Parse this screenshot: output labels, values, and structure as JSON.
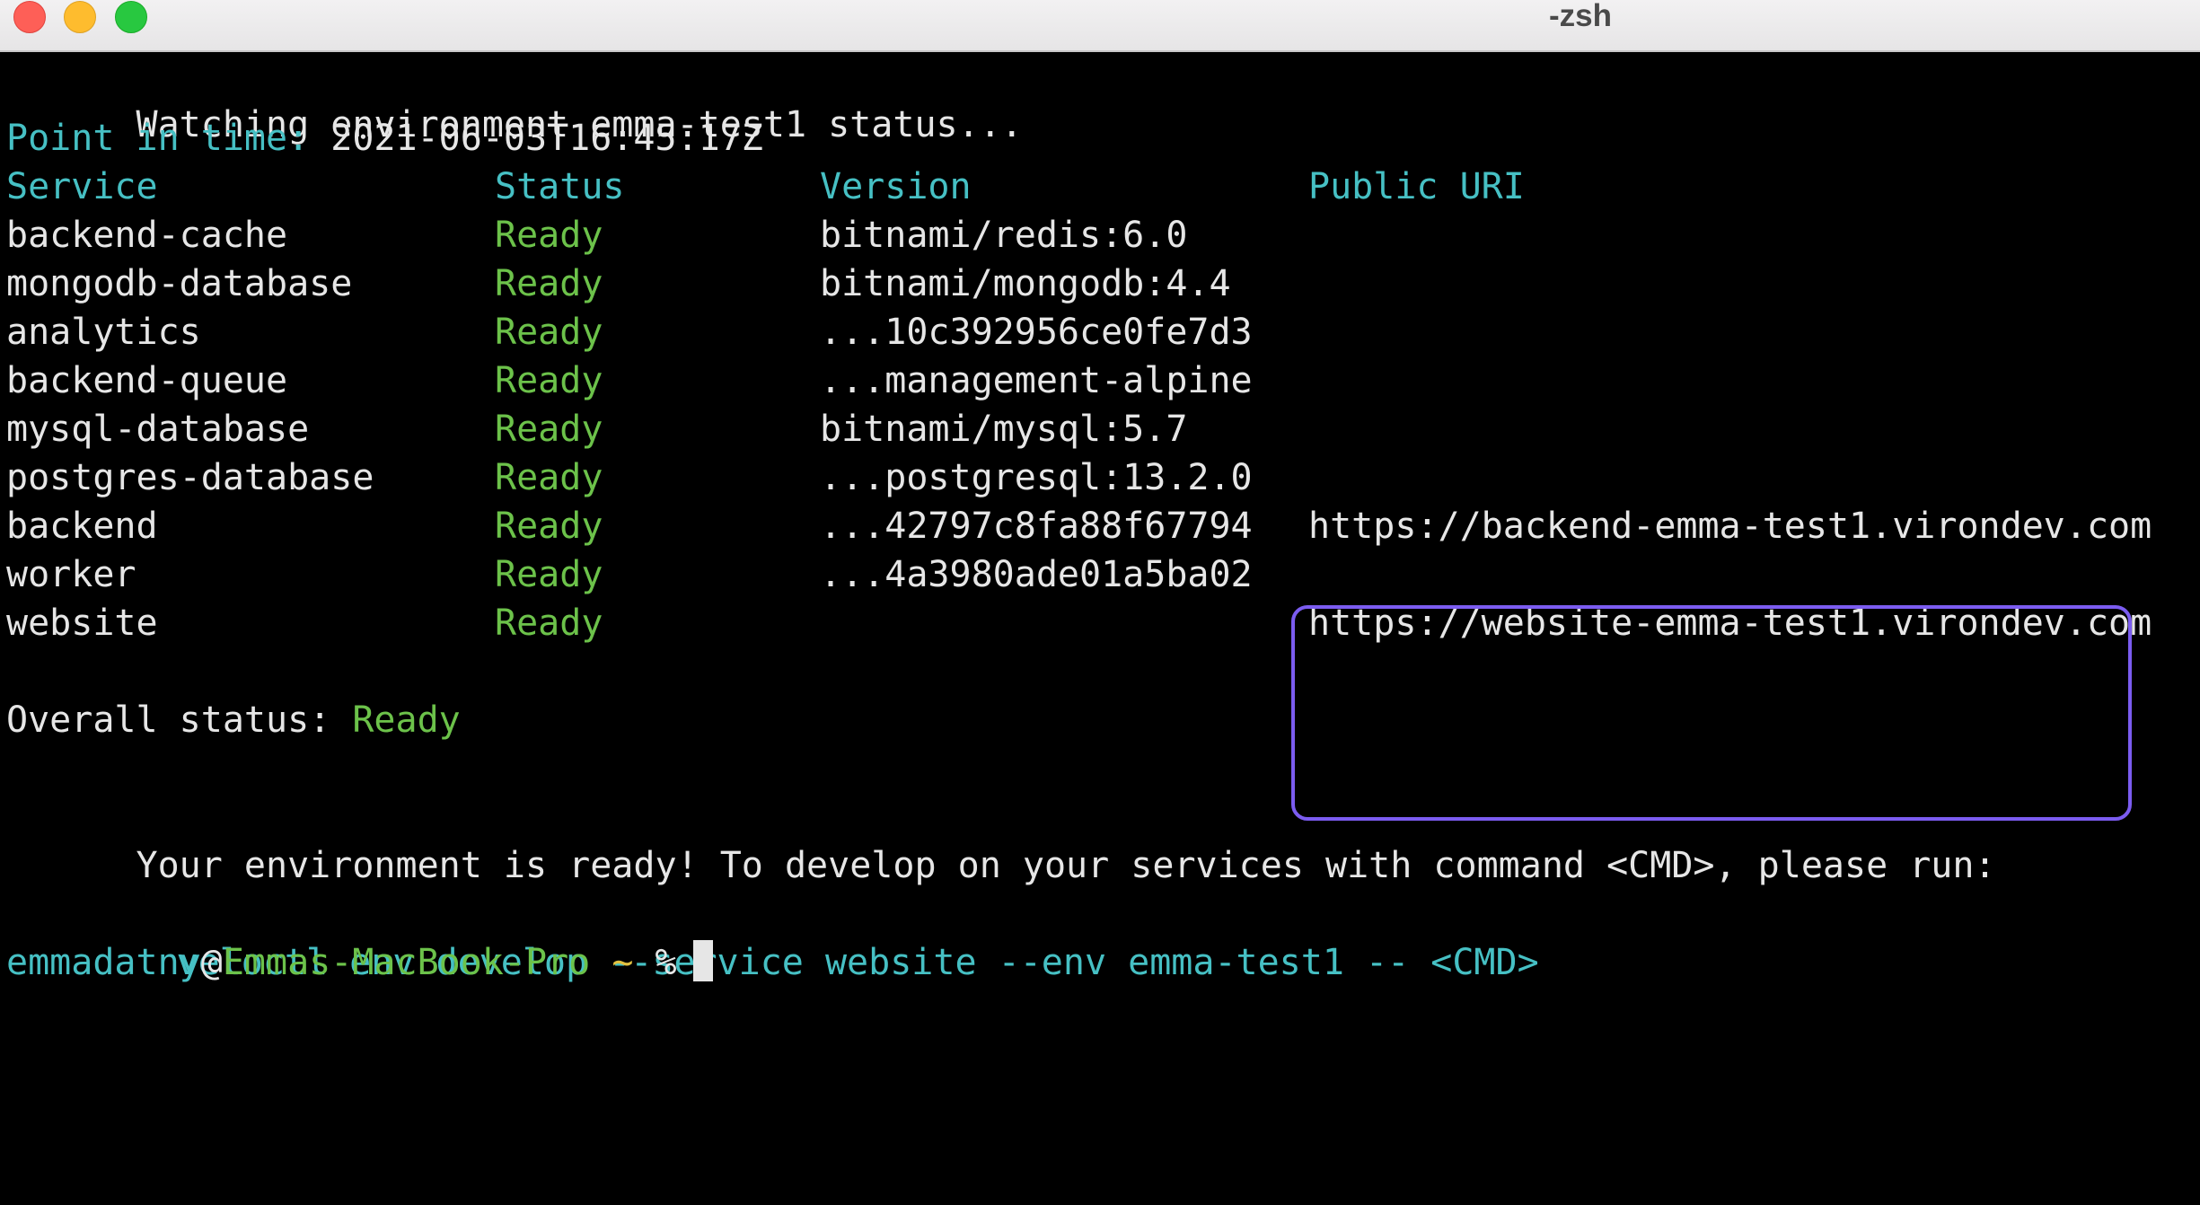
{
  "window": {
    "title": "-zsh"
  },
  "terminal": {
    "watching": "Watching environment emma-test1 status...",
    "point_in_time_label": "Point in time:",
    "point_in_time_value": "2021-06-03T16:45:17Z",
    "headers": {
      "service": "Service",
      "status": "Status",
      "version": "Version",
      "public_uri": "Public URI"
    },
    "rows": [
      {
        "service": "backend-cache",
        "status": "Ready",
        "version": "bitnami/redis:6.0",
        "uri": ""
      },
      {
        "service": "mongodb-database",
        "status": "Ready",
        "version": "bitnami/mongodb:4.4",
        "uri": ""
      },
      {
        "service": "analytics",
        "status": "Ready",
        "version": "...10c392956ce0fe7d3",
        "uri": ""
      },
      {
        "service": "backend-queue",
        "status": "Ready",
        "version": "...management-alpine",
        "uri": ""
      },
      {
        "service": "mysql-database",
        "status": "Ready",
        "version": "bitnami/mysql:5.7",
        "uri": ""
      },
      {
        "service": "postgres-database",
        "status": "Ready",
        "version": "...postgresql:13.2.0",
        "uri": ""
      },
      {
        "service": "backend",
        "status": "Ready",
        "version": "...42797c8fa88f67794",
        "uri": "https://backend-emma-test1.virondev.com"
      },
      {
        "service": "worker",
        "status": "Ready",
        "version": "...4a3980ade01a5ba02",
        "uri": ""
      },
      {
        "service": "website",
        "status": "Ready",
        "version": "",
        "uri": "https://website-emma-test1.virondev.com"
      }
    ],
    "overall_label": "Overall status:",
    "overall_value": "Ready",
    "ready_message": "Your environment is ready! To develop on your services with command <CMD>, please run:",
    "command": "veloctl env develop --service website --env emma-test1 -- <CMD>",
    "prompt": {
      "user": "emmadatny",
      "at": "@",
      "host": "Emmas-MacBook-Pro",
      "dir": "~",
      "symbol": "%"
    }
  },
  "colors": {
    "label_teal": "#46c0c4",
    "status_green": "#6cc24a",
    "highlight_border": "#7b5cf0",
    "background": "#000000"
  }
}
